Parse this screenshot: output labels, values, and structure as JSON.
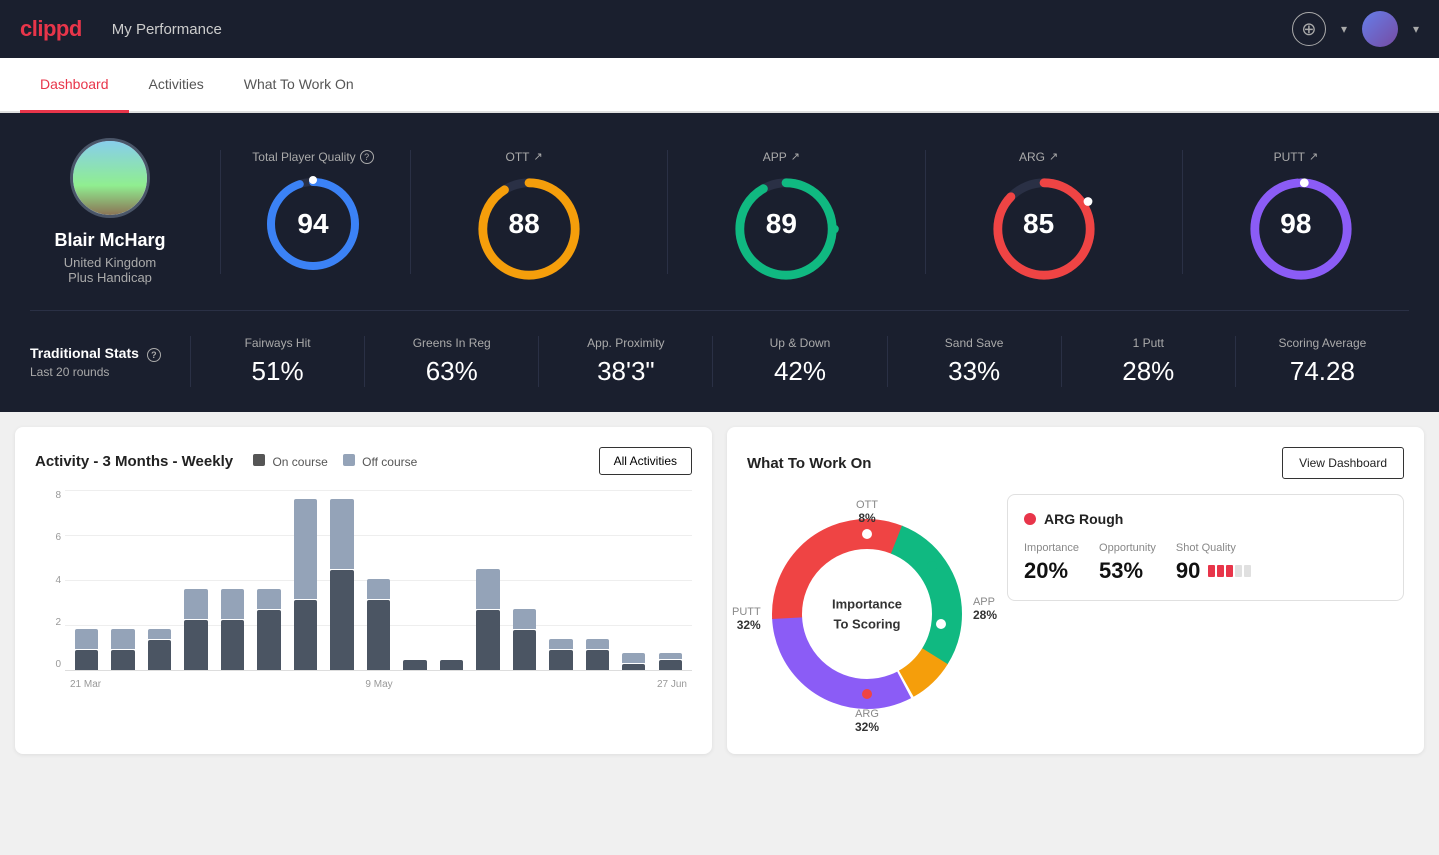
{
  "app": {
    "logo": "clippd",
    "header_title": "My Performance"
  },
  "nav": {
    "tabs": [
      {
        "label": "Dashboard",
        "active": true
      },
      {
        "label": "Activities",
        "active": false
      },
      {
        "label": "What To Work On",
        "active": false
      }
    ]
  },
  "player": {
    "name": "Blair McHarg",
    "country": "United Kingdom",
    "handicap": "Plus Handicap"
  },
  "total_quality": {
    "label": "Total Player Quality",
    "value": 94,
    "color": "#3b82f6"
  },
  "metrics": [
    {
      "label": "OTT",
      "trend": "up",
      "value": 88,
      "color": "#f59e0b"
    },
    {
      "label": "APP",
      "trend": "up",
      "value": 89,
      "color": "#10b981"
    },
    {
      "label": "ARG",
      "trend": "up",
      "value": 85,
      "color": "#ef4444"
    },
    {
      "label": "PUTT",
      "trend": "up",
      "value": 98,
      "color": "#8b5cf6"
    }
  ],
  "traditional_stats": {
    "label": "Traditional Stats",
    "sub": "Last 20 rounds",
    "items": [
      {
        "name": "Fairways Hit",
        "value": "51%"
      },
      {
        "name": "Greens In Reg",
        "value": "63%"
      },
      {
        "name": "App. Proximity",
        "value": "38'3\""
      },
      {
        "name": "Up & Down",
        "value": "42%"
      },
      {
        "name": "Sand Save",
        "value": "33%"
      },
      {
        "name": "1 Putt",
        "value": "28%"
      },
      {
        "name": "Scoring Average",
        "value": "74.28"
      }
    ]
  },
  "activity_chart": {
    "title": "Activity - 3 Months - Weekly",
    "legend_on": "On course",
    "legend_off": "Off course",
    "btn_label": "All Activities",
    "x_labels": [
      "21 Mar",
      "9 May",
      "27 Jun"
    ],
    "bars": [
      {
        "on": 1,
        "off": 1
      },
      {
        "on": 1,
        "off": 1
      },
      {
        "on": 1.5,
        "off": 0.5
      },
      {
        "on": 2.5,
        "off": 1.5
      },
      {
        "on": 2.5,
        "off": 1.5
      },
      {
        "on": 3,
        "off": 1
      },
      {
        "on": 3.5,
        "off": 5
      },
      {
        "on": 5,
        "off": 3.5
      },
      {
        "on": 3.5,
        "off": 1
      },
      {
        "on": 0.5,
        "off": 0
      },
      {
        "on": 0.5,
        "off": 0
      },
      {
        "on": 3,
        "off": 2
      },
      {
        "on": 2,
        "off": 1
      },
      {
        "on": 1,
        "off": 0.5
      },
      {
        "on": 1,
        "off": 0.5
      },
      {
        "on": 0.3,
        "off": 0.5
      },
      {
        "on": 0.5,
        "off": 0.3
      }
    ],
    "y_labels": [
      "8",
      "6",
      "4",
      "2",
      "0"
    ]
  },
  "what_to_work_on": {
    "title": "What To Work On",
    "btn_label": "View Dashboard",
    "center_text": "Importance\nTo Scoring",
    "segments": [
      {
        "label": "OTT",
        "pct": "8%",
        "color": "#f59e0b"
      },
      {
        "label": "APP",
        "pct": "28%",
        "color": "#10b981"
      },
      {
        "label": "ARG",
        "pct": "32%",
        "color": "#ef4444"
      },
      {
        "label": "PUTT",
        "pct": "32%",
        "color": "#8b5cf6"
      }
    ],
    "detail": {
      "title": "ARG Rough",
      "importance_label": "Importance",
      "importance_value": "20%",
      "opportunity_label": "Opportunity",
      "opportunity_value": "53%",
      "quality_label": "Shot Quality",
      "quality_value": "90"
    }
  }
}
